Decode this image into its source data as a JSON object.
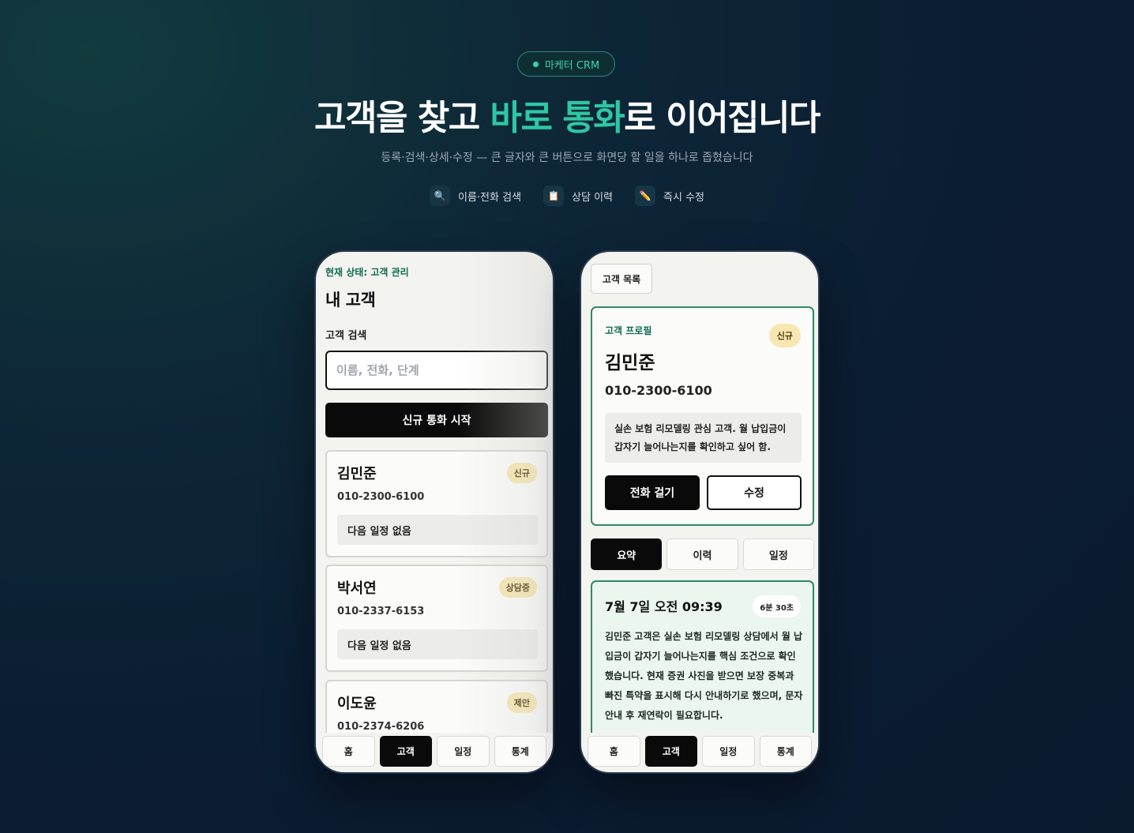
{
  "hero": {
    "badge": "마케터 CRM",
    "title_part1": "고객을 찾고 ",
    "title_accent": "바로 통화",
    "title_part2": "로 이어집니다",
    "subtitle": "등록·검색·상세·수정 — 큰 글자와 큰 버튼으로 화면당 할 일을 하나로 좁혔습니다",
    "features": [
      {
        "icon": "🔍",
        "icon_name": "search-icon",
        "label": "이름·전화 검색"
      },
      {
        "icon": "📋",
        "icon_name": "clipboard-icon",
        "label": "상담 이력"
      },
      {
        "icon": "✏️",
        "icon_name": "pencil-icon",
        "label": "즉시 수정"
      }
    ]
  },
  "list_screen": {
    "status": "현재 상태: 고객 관리",
    "title": "내 고객",
    "search_label": "고객 검색",
    "search_placeholder": "이름, 전화, 단계",
    "new_call_button": "신규 통화 시작",
    "customers": [
      {
        "name": "김민준",
        "phone": "010-2300-6100",
        "stage": "신규",
        "next": "다음 일정 없음"
      },
      {
        "name": "박서연",
        "phone": "010-2337-6153",
        "stage": "상담중",
        "next": "다음 일정 없음"
      },
      {
        "name": "이도윤",
        "phone": "010-2374-6206",
        "stage": "제안",
        "next": ""
      }
    ],
    "tabs": [
      "홈",
      "고객",
      "일정",
      "통계"
    ],
    "active_tab": "고객"
  },
  "detail_screen": {
    "back_button": "고객 목록",
    "profile_label": "고객 프로필",
    "stage": "신규",
    "name": "김민준",
    "phone": "010-2300-6100",
    "note": "실손 보험 리모델링 관심 고객. 월 납입금이 갑자기 늘어나는지를 확인하고 싶어 함.",
    "call_button": "전화 걸기",
    "edit_button": "수정",
    "segments": [
      "요약",
      "이력",
      "일정"
    ],
    "active_segment": "요약",
    "history": {
      "date": "7월 7일 오전 09:39",
      "duration": "6분 30초",
      "body": "김민준 고객은 실손 보험 리모델링 상담에서 월 납입금이 갑자기 늘어나는지를 핵심 조건으로 확인했습니다. 현재 증권 사진을 받으면 보장 중복과 빠진 특약을 표시해 다시 안내하기로 했으며, 문자 안내 후 재연락이 필요합니다."
    },
    "tabs": [
      "홈",
      "고객",
      "일정",
      "통계"
    ],
    "active_tab": "고객"
  },
  "colors": {
    "accent": "#2ec7a4",
    "brand_green": "#2e8a63",
    "badge_yellow": "#f7e7b0"
  }
}
